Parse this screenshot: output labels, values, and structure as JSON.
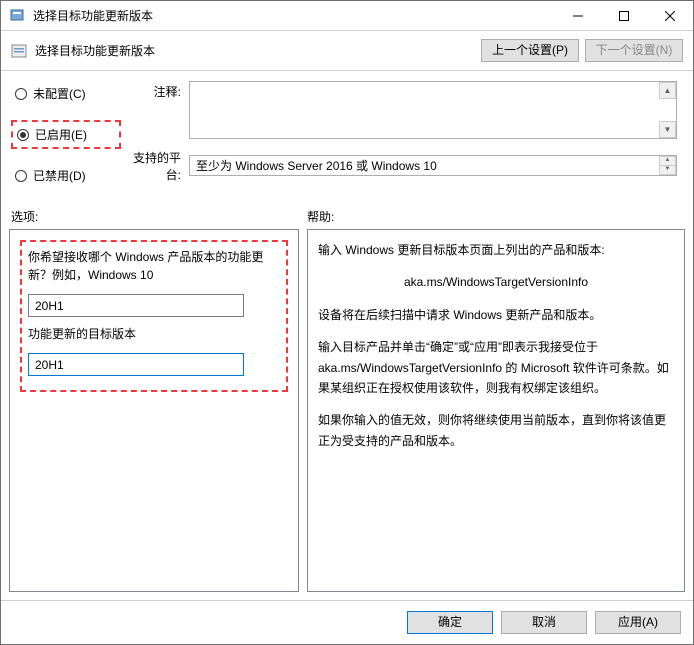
{
  "titlebar": {
    "title": "选择目标功能更新版本"
  },
  "header": {
    "title": "选择目标功能更新版本",
    "prev_setting": "上一个设置(P)",
    "next_setting": "下一个设置(N)"
  },
  "radio": {
    "not_configured": "未配置(C)",
    "enabled": "已启用(E)",
    "disabled": "已禁用(D)"
  },
  "comment": {
    "label": "注释:"
  },
  "platform": {
    "label": "支持的平台:",
    "value": "至少为 Windows Server 2016 或 Windows 10"
  },
  "section": {
    "options": "选项:",
    "help": "帮助:"
  },
  "options": {
    "product_label": "你希望接收哪个 Windows 产品版本的功能更新？例如，Windows 10",
    "product_value": "20H1",
    "target_label": "功能更新的目标版本",
    "target_value": "20H1"
  },
  "help": {
    "p1": "输入 Windows 更新目标版本页面上列出的产品和版本:",
    "p2": "aka.ms/WindowsTargetVersionInfo",
    "p3": "设备将在后续扫描中请求 Windows 更新产品和版本。",
    "p4": "输入目标产品并单击“确定”或“应用”即表示我接受位于 aka.ms/WindowsTargetVersionInfo 的 Microsoft 软件许可条款。如果某组织正在授权使用该软件，则我有权绑定该组织。",
    "p5": "如果你输入的值无效，则你将继续使用当前版本，直到你将该值更正为受支持的产品和版本。"
  },
  "footer": {
    "ok": "确定",
    "cancel": "取消",
    "apply": "应用(A)"
  }
}
